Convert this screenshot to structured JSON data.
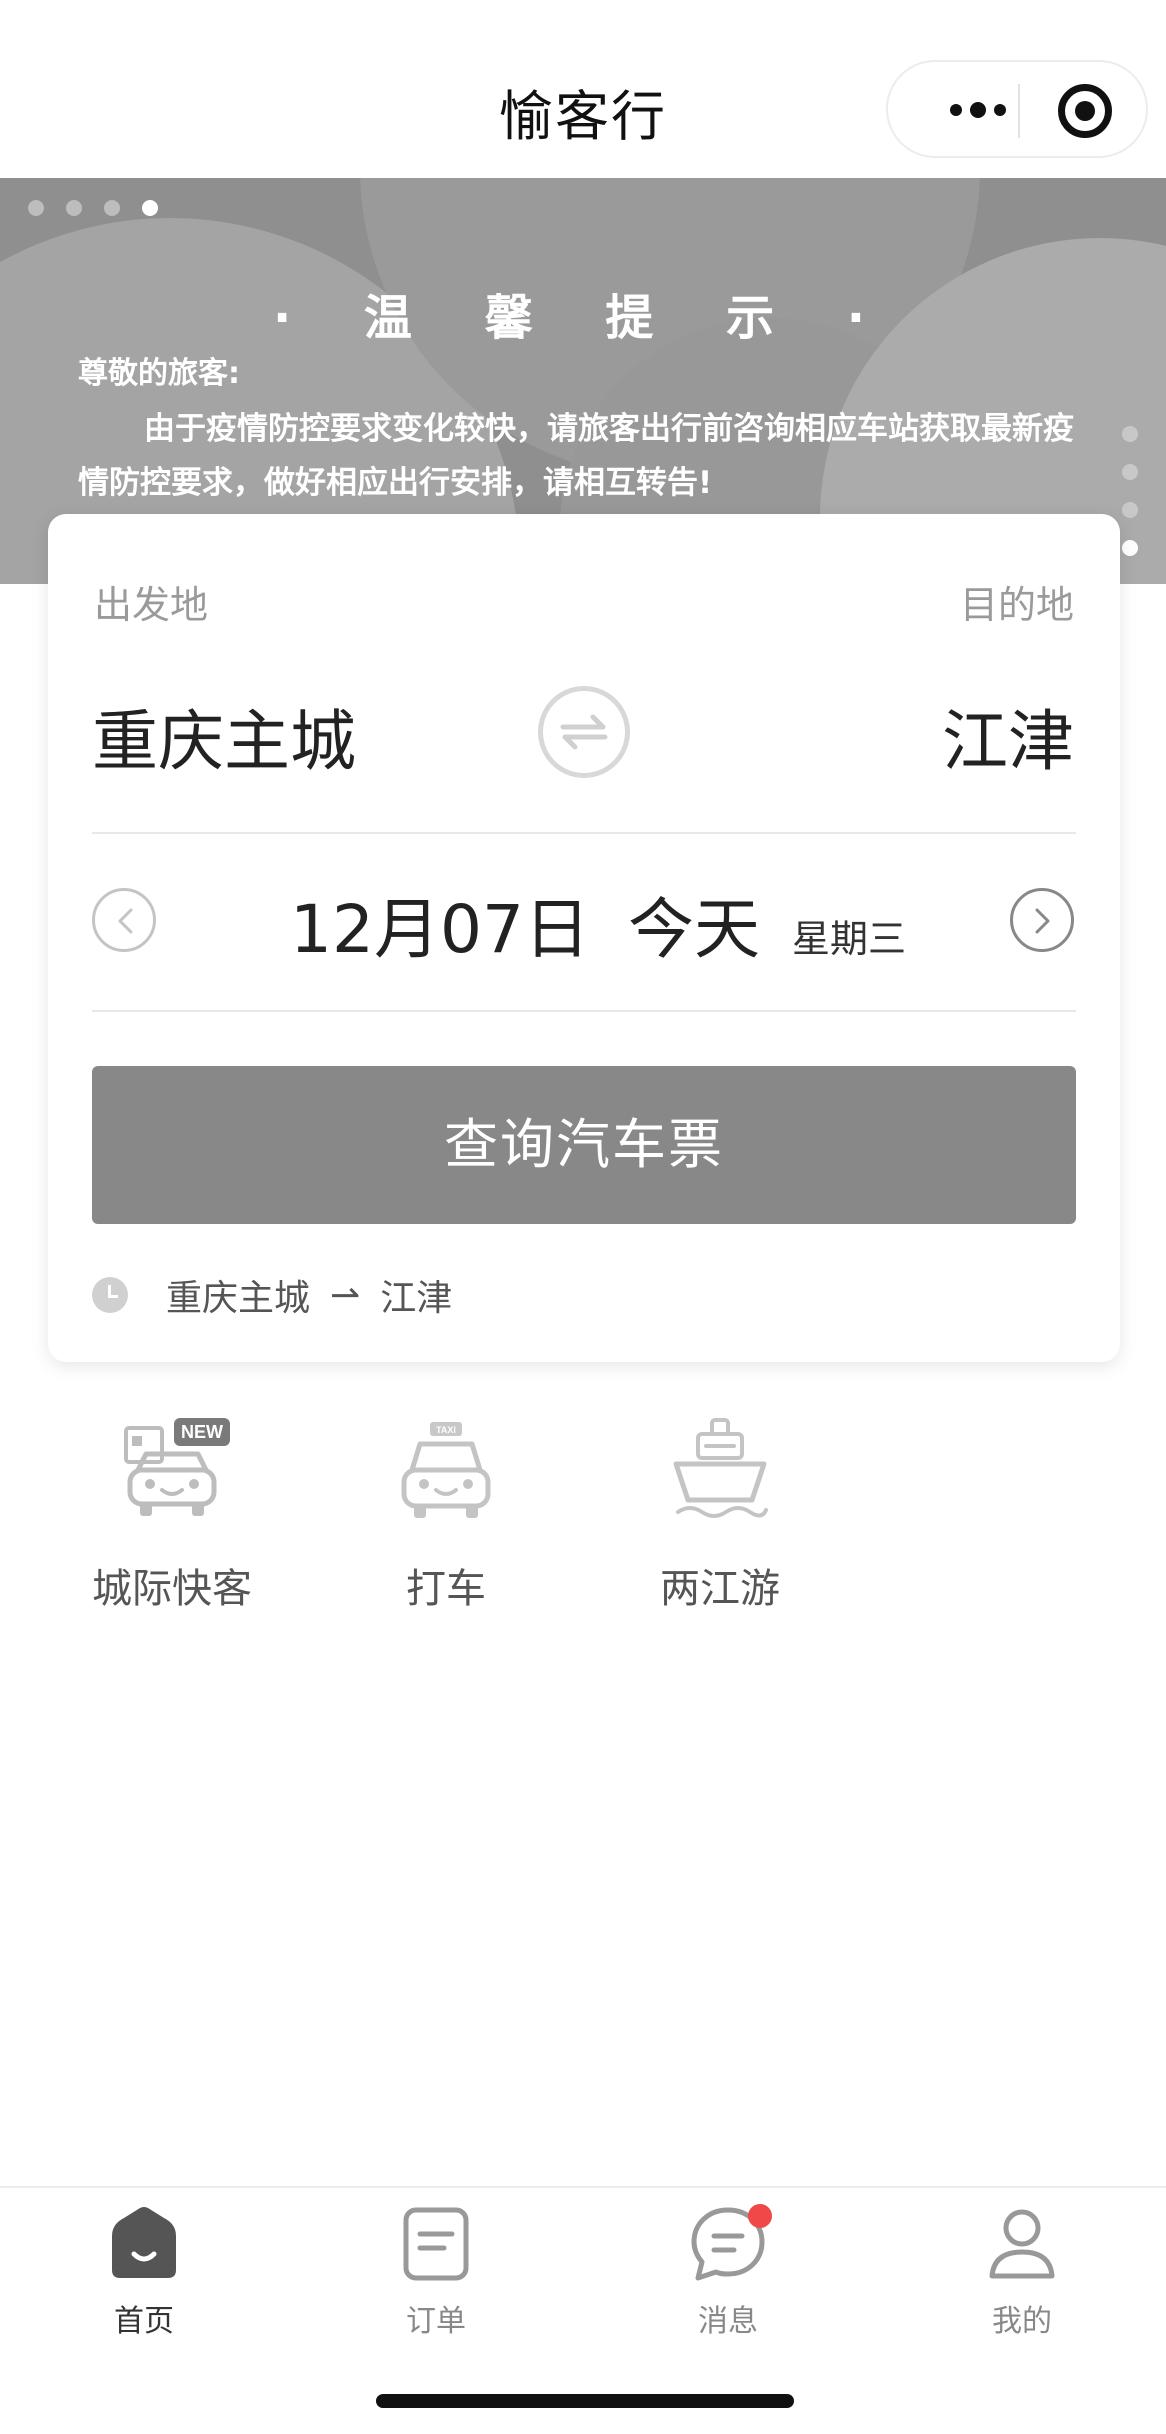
{
  "navbar": {
    "title": "愉客行"
  },
  "banner": {
    "title": "· 温 馨 提 示 ·",
    "greeting": "尊敬的旅客:",
    "body": "由于疫情防控要求变化较快，请旅客出行前咨询相应车站获取最新疫情防控要求，做好相应出行安排，请相互转告!"
  },
  "search": {
    "from_label": "出发地",
    "to_label": "目的地",
    "from_city": "重庆主城",
    "to_city": "江津",
    "date": "12月07日",
    "day_label": "今天",
    "weekday": "星期三",
    "query_button": "查询汽车票",
    "history": {
      "from": "重庆主城",
      "arrow": "⇀",
      "to": "江津"
    }
  },
  "services": [
    {
      "label": "城际快客",
      "icon": "car-new-icon",
      "badge": "NEW"
    },
    {
      "label": "打车",
      "icon": "taxi-icon",
      "badge": "TAXI"
    },
    {
      "label": "两江游",
      "icon": "ship-icon"
    }
  ],
  "tabbar": [
    {
      "label": "首页",
      "icon": "home-icon",
      "active": true
    },
    {
      "label": "订单",
      "icon": "order-icon"
    },
    {
      "label": "消息",
      "icon": "message-icon",
      "has_dot": true
    },
    {
      "label": "我的",
      "icon": "profile-icon"
    }
  ],
  "colors": {
    "button": "#888888",
    "badge_dot": "#f04848",
    "banner": "#8f8f8f"
  }
}
